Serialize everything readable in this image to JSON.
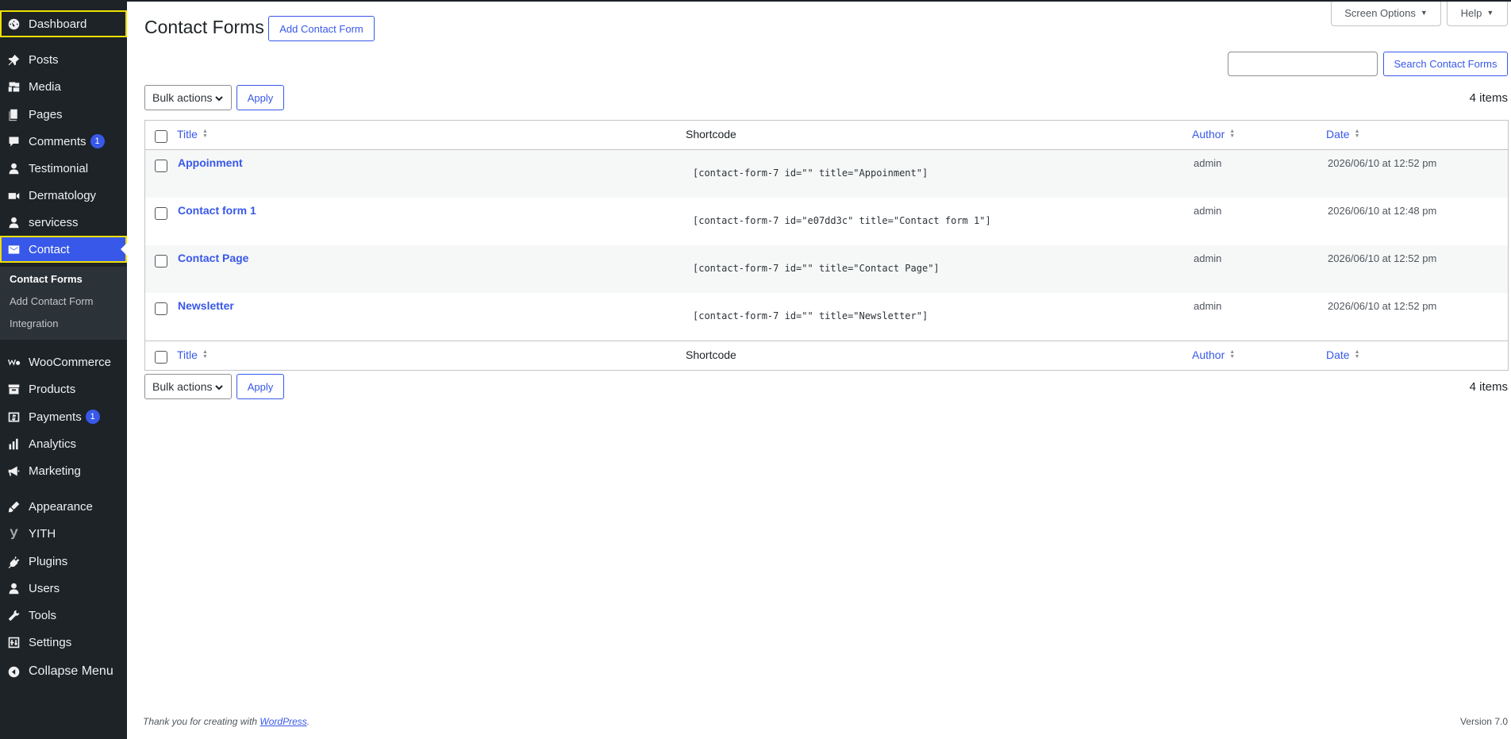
{
  "sidebar": {
    "items": [
      {
        "label": "Dashboard",
        "icon": "dashboard-icon"
      },
      {
        "label": "Posts",
        "icon": "pin-icon"
      },
      {
        "label": "Media",
        "icon": "media-icon"
      },
      {
        "label": "Pages",
        "icon": "pages-icon"
      },
      {
        "label": "Comments",
        "icon": "comment-icon",
        "badge": "1"
      },
      {
        "label": "Testimonial",
        "icon": "person-icon"
      },
      {
        "label": "Dermatology",
        "icon": "video-icon"
      },
      {
        "label": "servicess",
        "icon": "person-icon"
      },
      {
        "label": "Contact",
        "icon": "mail-icon"
      },
      {
        "label": "WooCommerce",
        "icon": "woo-icon"
      },
      {
        "label": "Products",
        "icon": "archive-icon"
      },
      {
        "label": "Payments",
        "icon": "dollar-icon",
        "badge": "1"
      },
      {
        "label": "Analytics",
        "icon": "chart-bar-icon"
      },
      {
        "label": "Marketing",
        "icon": "megaphone-icon"
      },
      {
        "label": "Appearance",
        "icon": "brush-icon"
      },
      {
        "label": "YITH",
        "icon": "yith-icon"
      },
      {
        "label": "Plugins",
        "icon": "plugin-icon"
      },
      {
        "label": "Users",
        "icon": "person-icon"
      },
      {
        "label": "Tools",
        "icon": "wrench-icon"
      },
      {
        "label": "Settings",
        "icon": "settings-icon"
      },
      {
        "label": "Collapse Menu",
        "icon": "collapse-icon"
      }
    ],
    "submenu": [
      "Contact Forms",
      "Add Contact Form",
      "Integration"
    ]
  },
  "header": {
    "title": "Contact Forms",
    "add_button": "Add Contact Form",
    "screen_options": "Screen Options",
    "help": "Help"
  },
  "search": {
    "button": "Search Contact Forms",
    "value": ""
  },
  "bulk": {
    "label": "Bulk actions",
    "apply": "Apply",
    "count": "4 items"
  },
  "table": {
    "columns": [
      "Title",
      "Shortcode",
      "Author",
      "Date"
    ],
    "rows": [
      {
        "title": "Appoinment",
        "shortcode": "[contact-form-7 id=\"\" title=\"Appoinment\"]",
        "author": "admin",
        "date": "2026/06/10 at 12:52 pm"
      },
      {
        "title": "Contact form 1",
        "shortcode": "[contact-form-7 id=\"e07dd3c\" title=\"Contact form 1\"]",
        "author": "admin",
        "date": "2026/06/10 at 12:48 pm"
      },
      {
        "title": "Contact Page",
        "shortcode": "[contact-form-7 id=\"\" title=\"Contact Page\"]",
        "author": "admin",
        "date": "2026/06/10 at 12:52 pm"
      },
      {
        "title": "Newsletter",
        "shortcode": "[contact-form-7 id=\"\" title=\"Newsletter\"]",
        "author": "admin",
        "date": "2026/06/10 at 12:52 pm"
      }
    ]
  },
  "footer": {
    "thanks_prefix": "Thank you for creating with ",
    "link": "WordPress",
    "thanks_suffix": ".",
    "version": "Version 7.0"
  },
  "colors": {
    "sidebar_bg": "#1d2327",
    "accent": "#3858e9",
    "focus_outline": "#f0e000"
  }
}
